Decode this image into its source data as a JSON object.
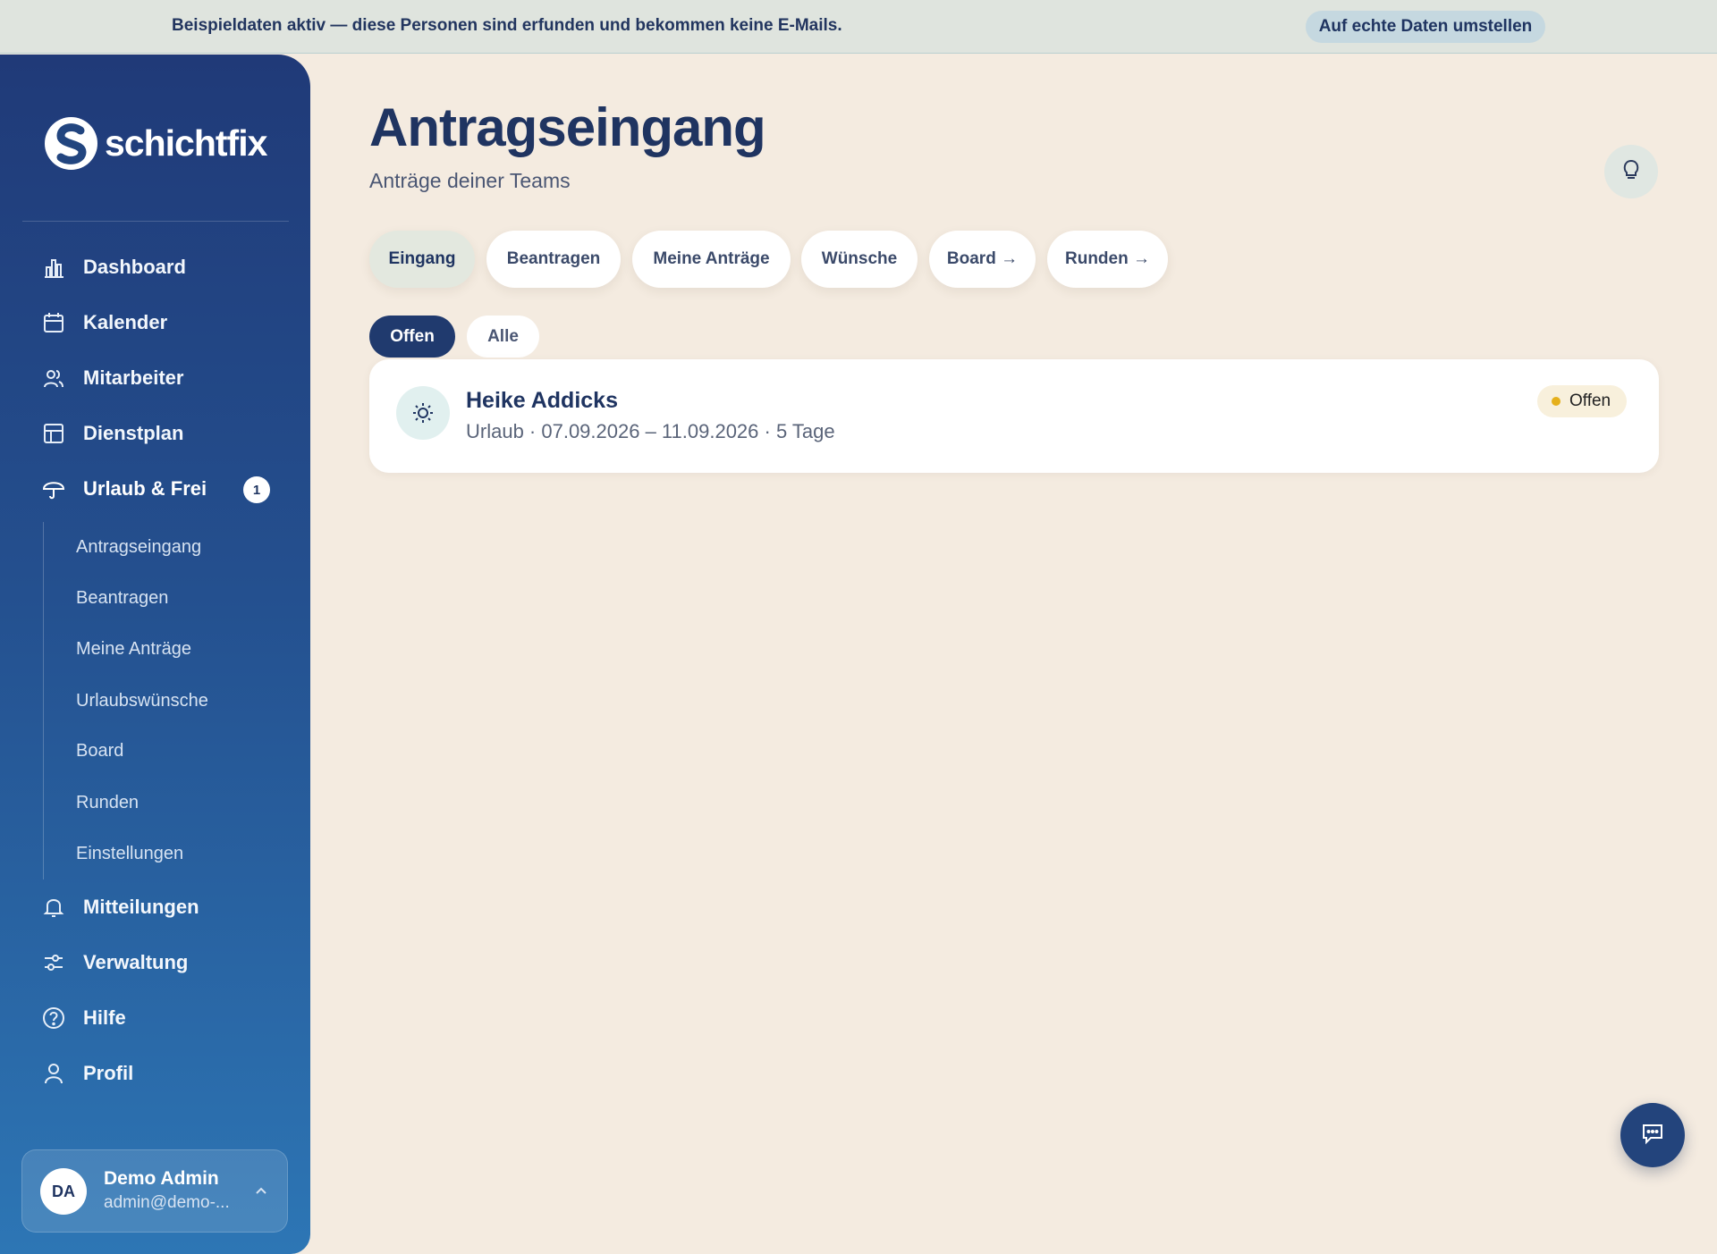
{
  "banner": {
    "text": "Beispieldaten aktiv — diese Personen sind erfunden und bekommen keine E-Mails.",
    "button": "Auf echte Daten umstellen"
  },
  "sidebar": {
    "logo": "schichtfix",
    "nav": [
      {
        "label": "Dashboard",
        "icon": "bar-chart-icon"
      },
      {
        "label": "Kalender",
        "icon": "calendar-icon"
      },
      {
        "label": "Mitarbeiter",
        "icon": "users-icon"
      },
      {
        "label": "Dienstplan",
        "icon": "layout-icon"
      },
      {
        "label": "Urlaub & Frei",
        "icon": "umbrella-icon",
        "badge": "1"
      },
      {
        "label": "Mitteilungen",
        "icon": "bell-icon"
      },
      {
        "label": "Verwaltung",
        "icon": "sliders-icon"
      },
      {
        "label": "Hilfe",
        "icon": "help-circle-icon"
      },
      {
        "label": "Profil",
        "icon": "user-icon"
      }
    ],
    "subnav": [
      "Antragseingang",
      "Beantragen",
      "Meine Anträge",
      "Urlaubswünsche",
      "Board",
      "Runden",
      "Einstellungen"
    ],
    "user": {
      "initials": "DA",
      "name": "Demo Admin",
      "email": "admin@demo-..."
    }
  },
  "main": {
    "title": "Antragseingang",
    "subtitle": "Anträge deiner Teams",
    "tabs": [
      "Eingang",
      "Beantragen",
      "Meine Anträge",
      "Wünsche",
      "Board →",
      "Runden →"
    ],
    "filters": [
      "Offen",
      "Alle"
    ],
    "requests": [
      {
        "name": "Heike Addicks",
        "details": "Urlaub · 07.09.2026 – 11.09.2026 · 5 Tage",
        "status": "Offen",
        "icon": "sun-icon"
      }
    ]
  },
  "colors": {
    "sidebar_top": "#203a78",
    "sidebar_bottom": "#2d76b5",
    "background": "#f4ebe0",
    "accent_navy": "#1f3461",
    "status_dot": "#e5b01c"
  }
}
